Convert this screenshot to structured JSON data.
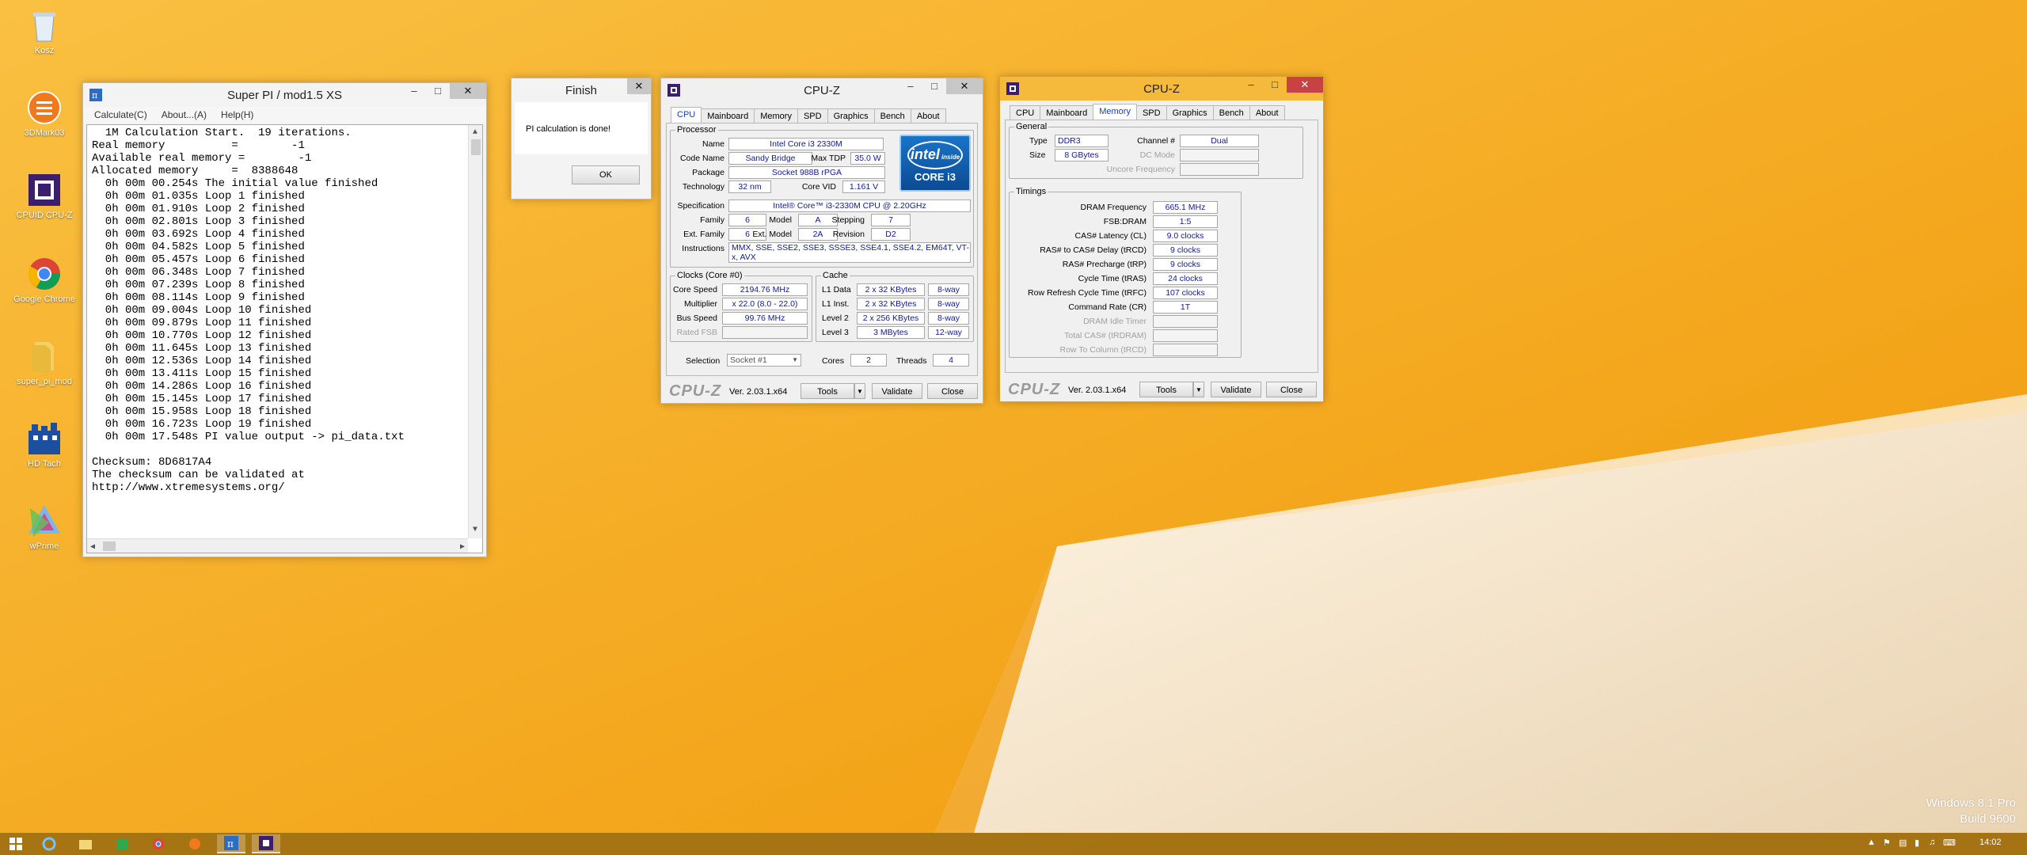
{
  "desktop": {
    "icons": [
      {
        "label": "Kosz",
        "icon": "recycle-bin-icon"
      },
      {
        "label": "3DMark03",
        "icon": "3dmark-icon"
      },
      {
        "label": "CPUID CPU-Z",
        "icon": "cpuz-icon"
      },
      {
        "label": "Google Chrome",
        "icon": "chrome-icon"
      },
      {
        "label": "super_pi_mod",
        "icon": "folder-icon"
      },
      {
        "label": "HD Tach",
        "icon": "hdtach-icon"
      },
      {
        "label": "wPrime",
        "icon": "wprime-icon"
      }
    ],
    "watermark": {
      "line1": "Windows 8.1 Pro",
      "line2": "Build 9600"
    },
    "colors": {
      "accent": "#f6a50d",
      "highlight": "#fbe9c8"
    }
  },
  "superpi": {
    "title": "Super PI / mod1.5 XS",
    "menu": [
      "Calculate(C)",
      "About...(A)",
      "Help(H)"
    ],
    "lines": [
      "  1M Calculation Start.  19 iterations.",
      "Real memory          =        -1",
      "Available real memory =        -1",
      "Allocated memory     =  8388648",
      "  0h 00m 00.254s The initial value finished",
      "  0h 00m 01.035s Loop 1 finished",
      "  0h 00m 01.910s Loop 2 finished",
      "  0h 00m 02.801s Loop 3 finished",
      "  0h 00m 03.692s Loop 4 finished",
      "  0h 00m 04.582s Loop 5 finished",
      "  0h 00m 05.457s Loop 6 finished",
      "  0h 00m 06.348s Loop 7 finished",
      "  0h 00m 07.239s Loop 8 finished",
      "  0h 00m 08.114s Loop 9 finished",
      "  0h 00m 09.004s Loop 10 finished",
      "  0h 00m 09.879s Loop 11 finished",
      "  0h 00m 10.770s Loop 12 finished",
      "  0h 00m 11.645s Loop 13 finished",
      "  0h 00m 12.536s Loop 14 finished",
      "  0h 00m 13.411s Loop 15 finished",
      "  0h 00m 14.286s Loop 16 finished",
      "  0h 00m 15.145s Loop 17 finished",
      "  0h 00m 15.958s Loop 18 finished",
      "  0h 00m 16.723s Loop 19 finished",
      "  0h 00m 17.548s PI value output -> pi_data.txt",
      "",
      "Checksum: 8D6817A4",
      "The checksum can be validated at",
      "http://www.xtremesystems.org/"
    ]
  },
  "finish": {
    "title": "Finish",
    "message": "PI calculation is done!",
    "ok": "OK"
  },
  "cpuz1": {
    "title": "CPU-Z",
    "tabs": [
      "CPU",
      "Mainboard",
      "Memory",
      "SPD",
      "Graphics",
      "Bench",
      "About"
    ],
    "processor": {
      "legend": "Processor",
      "name_label": "Name",
      "name": "Intel Core i3 2330M",
      "codename_label": "Code Name",
      "codename": "Sandy Bridge",
      "maxtdp_label": "Max TDP",
      "maxtdp": "35.0 W",
      "package_label": "Package",
      "package": "Socket 988B rPGA",
      "technology_label": "Technology",
      "technology": "32 nm",
      "corevid_label": "Core VID",
      "corevid": "1.161 V",
      "spec_label": "Specification",
      "spec": "Intel® Core™ i3-2330M CPU @ 2.20GHz",
      "family_label": "Family",
      "family": "6",
      "model_label": "Model",
      "model": "A",
      "stepping_label": "Stepping",
      "stepping": "7",
      "extfamily_label": "Ext. Family",
      "extfamily": "6",
      "extmodel_label": "Ext. Model",
      "extmodel": "2A",
      "revision_label": "Revision",
      "revision": "D2",
      "instr_label": "Instructions",
      "instructions": "MMX, SSE, SSE2, SSE3, SSSE3, SSE4.1, SSE4.2, EM64T, VT-x, AVX"
    },
    "logo": {
      "top": "intel",
      "inside": "inside",
      "bottom": "CORE i3",
      "color": "#0b5ea8"
    },
    "clocks": {
      "legend": "Clocks (Core #0)",
      "corespeed_label": "Core Speed",
      "corespeed": "2194.76 MHz",
      "multiplier_label": "Multiplier",
      "multiplier": "x 22.0 (8.0 - 22.0)",
      "busspeed_label": "Bus Speed",
      "busspeed": "99.76 MHz",
      "ratedfsb_label": "Rated FSB"
    },
    "cache": {
      "legend": "Cache",
      "rows": [
        {
          "label": "L1 Data",
          "size": "2 x 32 KBytes",
          "way": "8-way"
        },
        {
          "label": "L1 Inst.",
          "size": "2 x 32 KBytes",
          "way": "8-way"
        },
        {
          "label": "Level 2",
          "size": "2 x 256 KBytes",
          "way": "8-way"
        },
        {
          "label": "Level 3",
          "size": "3 MBytes",
          "way": "12-way"
        }
      ]
    },
    "selection": {
      "label": "Selection",
      "value": "Socket #1",
      "cores_label": "Cores",
      "cores": "2",
      "threads_label": "Threads",
      "threads": "4"
    },
    "footer": {
      "brand": "CPU-Z",
      "version": "Ver. 2.03.1.x64",
      "tools": "Tools",
      "validate": "Validate",
      "close": "Close"
    }
  },
  "cpuz2": {
    "title": "CPU-Z",
    "tabs": [
      "CPU",
      "Mainboard",
      "Memory",
      "SPD",
      "Graphics",
      "Bench",
      "About"
    ],
    "general": {
      "legend": "General",
      "type_label": "Type",
      "type": "DDR3",
      "size_label": "Size",
      "size": "8 GBytes",
      "channel_label": "Channel #",
      "channel": "Dual",
      "dcmode_label": "DC Mode",
      "uncore_label": "Uncore Frequency"
    },
    "timings": {
      "legend": "Timings",
      "rows": [
        {
          "label": "DRAM Frequency",
          "value": "665.1 MHz",
          "enabled": true
        },
        {
          "label": "FSB:DRAM",
          "value": "1:5",
          "enabled": true
        },
        {
          "label": "CAS# Latency (CL)",
          "value": "9.0 clocks",
          "enabled": true
        },
        {
          "label": "RAS# to CAS# Delay (tRCD)",
          "value": "9 clocks",
          "enabled": true
        },
        {
          "label": "RAS# Precharge (tRP)",
          "value": "9 clocks",
          "enabled": true
        },
        {
          "label": "Cycle Time (tRAS)",
          "value": "24 clocks",
          "enabled": true
        },
        {
          "label": "Row Refresh Cycle Time (tRFC)",
          "value": "107 clocks",
          "enabled": true
        },
        {
          "label": "Command Rate (CR)",
          "value": "1T",
          "enabled": true
        },
        {
          "label": "DRAM Idle Timer",
          "value": "",
          "enabled": false
        },
        {
          "label": "Total CAS# (tRDRAM)",
          "value": "",
          "enabled": false
        },
        {
          "label": "Row To Column (tRCD)",
          "value": "",
          "enabled": false
        }
      ]
    },
    "footer": {
      "brand": "CPU-Z",
      "version": "Ver. 2.03.1.x64",
      "tools": "Tools",
      "validate": "Validate",
      "close": "Close"
    }
  },
  "taskbar": {
    "items": [
      "start-icon",
      "ie-icon",
      "explorer-icon",
      "store-icon",
      "chrome-icon",
      "3dmark-icon",
      "superpi-icon",
      "cpuz-icon"
    ],
    "clock": "14:02"
  }
}
